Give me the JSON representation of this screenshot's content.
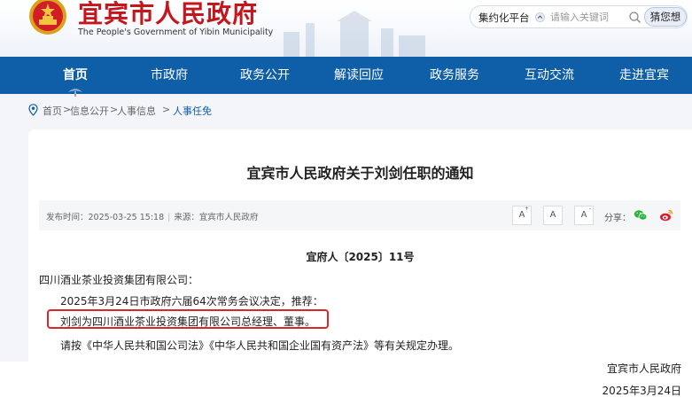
{
  "header": {
    "title_cn": "宜宾市人民政府",
    "title_en": "The People's Government of Yibin Municipality",
    "search": {
      "platform_label": "集约化平台",
      "placeholder": "请输入关键词",
      "guess_label": "猜您想"
    }
  },
  "nav": {
    "items": [
      "首页",
      "市政府",
      "政务公开",
      "解读回应",
      "政务服务",
      "互动交流",
      "走进宜宾"
    ],
    "active_index": 0
  },
  "breadcrumb": {
    "items": [
      "首页",
      "信息公开",
      "人事信息"
    ],
    "separator": ">",
    "current": "人事任免"
  },
  "article": {
    "title": "宜宾市人民政府关于刘剑任职的通知",
    "meta": {
      "published_label": "发布时间：",
      "published_value": "2025-03-25 15:18",
      "source_label": "来源：",
      "source_value": "宜宾市人民政府"
    },
    "font_controls": [
      "A",
      "A",
      "A"
    ],
    "font_control_marks": [
      "+",
      "",
      "-"
    ],
    "share_label": "分享：",
    "doc_number": "宜府人〔2025〕11号",
    "recipient": "四川酒业茶业投资集团有限公司：",
    "paragraphs": [
      "2025年3月24日市政府六届64次常务会议决定，推荐：",
      "刘剑为四川酒业茶业投资集团有限公司总经理、董事。",
      "请按《中华人民共和国公司法》《中华人民共和国企业国有资产法》等有关规定办理。"
    ],
    "signoff_org": "宜宾市人民政府",
    "signoff_date": "2025年3月24日"
  },
  "colors": {
    "brand_red": "#c4161c",
    "nav_blue": "#0f5ea8",
    "highlight_red": "#d9262a",
    "wechat_green": "#2db33c",
    "weibo_red": "#e6162d"
  },
  "icons": [
    "national-emblem-icon",
    "chevron-icon",
    "search-icon",
    "location-pin-icon",
    "wechat-icon",
    "weibo-icon"
  ]
}
